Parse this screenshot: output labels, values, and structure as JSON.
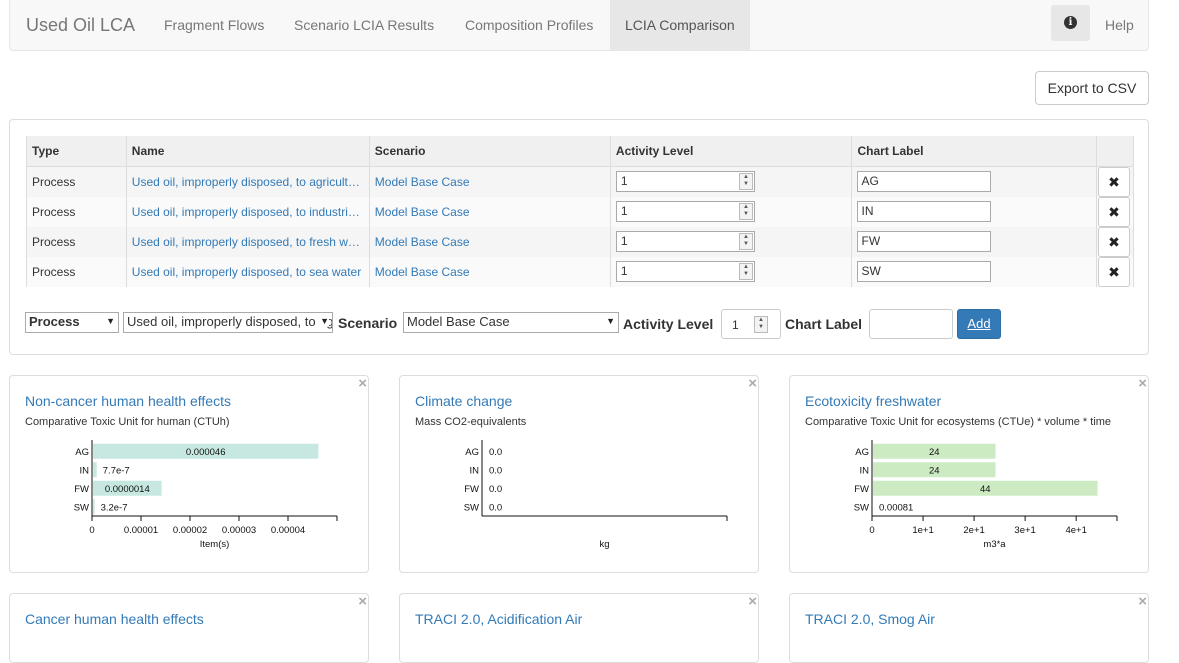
{
  "navbar": {
    "brand": "Used Oil LCA",
    "items": [
      "Fragment Flows",
      "Scenario LCIA Results",
      "Composition Profiles"
    ],
    "active": "LCIA Comparison",
    "help": "Help"
  },
  "toolbar": {
    "export_label": "Export to CSV"
  },
  "table": {
    "headers": [
      "Type",
      "Name",
      "Scenario",
      "Activity Level",
      "Chart Label"
    ],
    "rows": [
      {
        "type": "Process",
        "name": "Used oil, improperly disposed, to agricultural soil",
        "scenario": "Model Base Case",
        "activity": "1",
        "label": "AG"
      },
      {
        "type": "Process",
        "name": "Used oil, improperly disposed, to industrial soil",
        "scenario": "Model Base Case",
        "activity": "1",
        "label": "IN"
      },
      {
        "type": "Process",
        "name": "Used oil, improperly disposed, to fresh water",
        "scenario": "Model Base Case",
        "activity": "1",
        "label": "FW"
      },
      {
        "type": "Process",
        "name": "Used oil, improperly disposed, to sea water",
        "scenario": "Model Base Case",
        "activity": "1",
        "label": "SW"
      }
    ]
  },
  "add_row": {
    "type_value": "Process",
    "name_value": "Used oil, improperly disposed, to agricultural soil",
    "scenario_label": "Scenario",
    "scenario_value": "Model Base Case",
    "activity_label": "Activity Level",
    "activity_value": "1",
    "chart_label_label": "Chart Label",
    "chart_label_value": "",
    "add_label": "Add"
  },
  "icons": {
    "remove": "✖",
    "close": "×",
    "info": "i",
    "caret": "▼",
    "spin_up": "▲",
    "spin_down": "▼"
  },
  "colors": {
    "noncancer_bar": "#c6e8e0",
    "ecotox_bar": "#cdebc3",
    "link": "#337ab7",
    "add_button": "#337ab7"
  },
  "charts_row2": [
    {
      "title": "Cancer human health effects"
    },
    {
      "title": "TRACI 2.0, Acidification Air"
    },
    {
      "title": "TRACI 2.0, Smog Air"
    }
  ],
  "chart_data": [
    {
      "type": "bar",
      "orientation": "horizontal",
      "title": "Non-cancer human health effects",
      "subtitle": "Comparative Toxic Unit for human (CTUh)",
      "xlabel": "Item(s)",
      "categories": [
        "AG",
        "IN",
        "FW",
        "SW"
      ],
      "values": [
        4.6e-05,
        7.7e-07,
        1.4e-05,
        3.2e-07
      ],
      "value_labels": [
        "0.000046",
        "7.7e-7",
        "0.0000014",
        "3.2e-7"
      ],
      "xlim": [
        0,
        5e-05
      ],
      "xticks": [
        0,
        1e-05,
        2e-05,
        3e-05,
        4e-05
      ],
      "xtick_labels": [
        "0",
        "0.00001",
        "0.00002",
        "0.00003",
        "0.00004"
      ],
      "color": "#c6e8e0"
    },
    {
      "type": "bar",
      "orientation": "horizontal",
      "title": "Climate change",
      "subtitle": "Mass CO2-equivalents",
      "xlabel": "kg",
      "categories": [
        "AG",
        "IN",
        "FW",
        "SW"
      ],
      "values": [
        0,
        0,
        0,
        0
      ],
      "value_labels": [
        "0.0",
        "0.0",
        "0.0",
        "0.0"
      ],
      "xlim": [
        0,
        1
      ],
      "xticks": [],
      "xtick_labels": [],
      "color": "#c6e8e0"
    },
    {
      "type": "bar",
      "orientation": "horizontal",
      "title": "Ecotoxicity freshwater",
      "subtitle": "Comparative Toxic Unit for ecosystems (CTUe) * volume * time",
      "xlabel": "m3*a",
      "categories": [
        "AG",
        "IN",
        "FW",
        "SW"
      ],
      "values": [
        24,
        24,
        44,
        0.00081
      ],
      "value_labels": [
        "24",
        "24",
        "44",
        "0.00081"
      ],
      "xlim": [
        0,
        48
      ],
      "xticks": [
        0,
        10,
        20,
        30,
        40
      ],
      "xtick_labels": [
        "0",
        "1e+1",
        "2e+1",
        "3e+1",
        "4e+1"
      ],
      "color": "#cdebc3"
    }
  ]
}
